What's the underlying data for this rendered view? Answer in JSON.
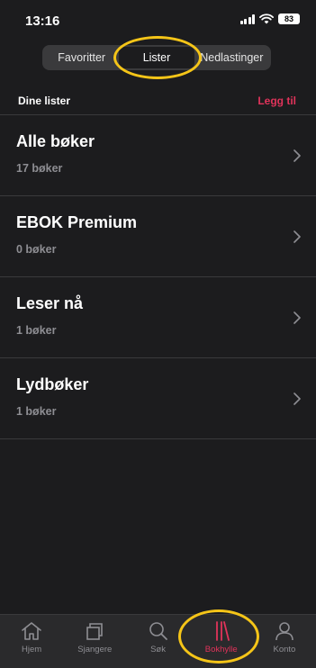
{
  "status_bar": {
    "time": "13:16",
    "battery": "83"
  },
  "segments": [
    {
      "label": "Favoritter",
      "active": false
    },
    {
      "label": "Lister",
      "active": true
    },
    {
      "label": "Nedlastinger",
      "active": false
    }
  ],
  "lists_header": {
    "title": "Dine lister",
    "add_label": "Legg til"
  },
  "lists": [
    {
      "title": "Alle bøker",
      "subtitle": "17 bøker"
    },
    {
      "title": "EBOK Premium",
      "subtitle": "0 bøker"
    },
    {
      "title": "Leser nå",
      "subtitle": "1 bøker"
    },
    {
      "title": "Lydbøker",
      "subtitle": "1 bøker"
    }
  ],
  "tabs": [
    {
      "label": "Hjem",
      "icon": "home-icon",
      "active": false
    },
    {
      "label": "Sjangere",
      "icon": "genres-icon",
      "active": false
    },
    {
      "label": "Søk",
      "icon": "search-icon",
      "active": false
    },
    {
      "label": "Bokhylle",
      "icon": "bookshelf-icon",
      "active": true
    },
    {
      "label": "Konto",
      "icon": "account-icon",
      "active": false
    }
  ],
  "colors": {
    "accent": "#e0335a",
    "highlight": "#f5c518",
    "background": "#1c1c1e"
  }
}
